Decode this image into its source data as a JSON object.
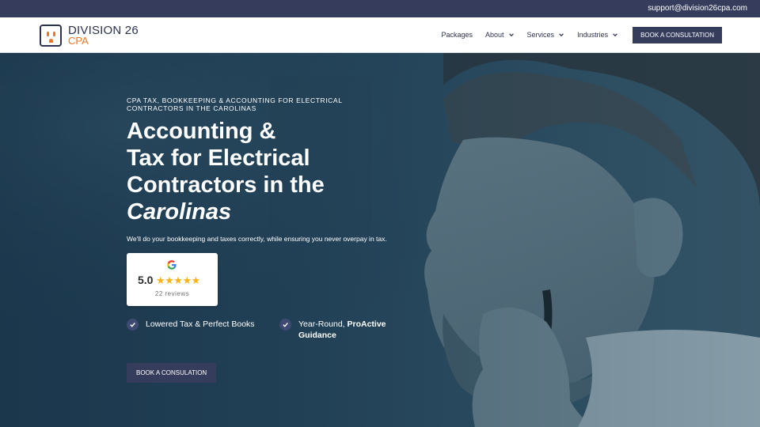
{
  "topbar": {
    "email": "support@division26cpa.com"
  },
  "logo": {
    "line1": "DIVISION 26",
    "line2": "CPA"
  },
  "nav": {
    "items": [
      {
        "label": "Packages",
        "dropdown": false
      },
      {
        "label": "About",
        "dropdown": true
      },
      {
        "label": "Services",
        "dropdown": true
      },
      {
        "label": "Industries",
        "dropdown": true
      }
    ],
    "cta": "BOOK A CONSULTATION"
  },
  "hero": {
    "kicker": "CPA TAX, BOOKKEEPING & ACCOUNTING FOR ELECTRICAL CONTRACTORS IN THE CAROLINAS",
    "headline": {
      "part1": "Accounting &",
      "part2": "Tax for ",
      "part3": "Electrical",
      "part4": "Contractors",
      "part5": " in the",
      "part6": "Carolinas"
    },
    "subtext": "We'll do your bookkeeping and taxes correctly, while ensuring you never overpay in tax.",
    "review": {
      "score": "5.0",
      "stars": "★★★★★",
      "count": "22 reviews",
      "rating_value": 5
    },
    "features": [
      {
        "text": "Lowered Tax & Perfect Books"
      },
      {
        "text_plain": "Year-Round, ",
        "text_bold": "ProActive Guidance"
      }
    ],
    "cta": "BOOK A CONSULATION"
  },
  "colors": {
    "navy": "#353c5c",
    "accent": "#e8772a",
    "star": "#f7b417"
  }
}
